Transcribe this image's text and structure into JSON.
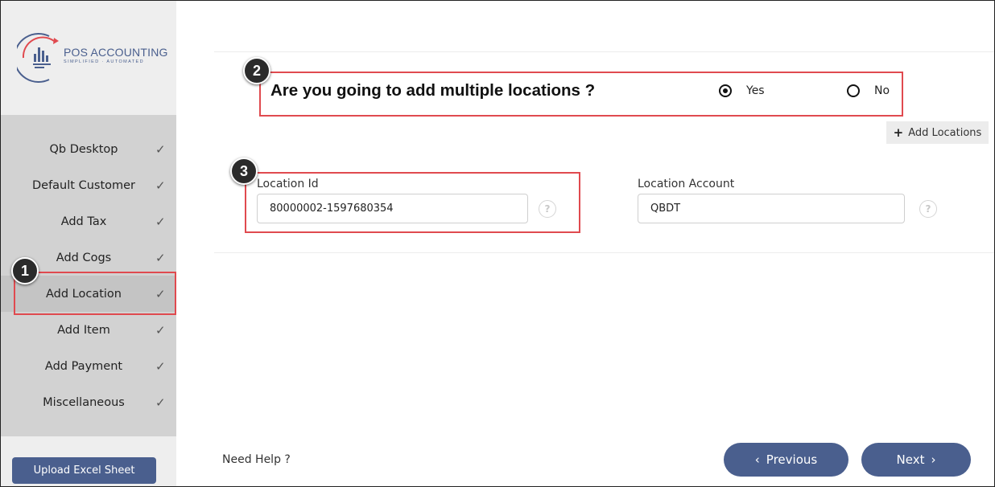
{
  "sidebar": {
    "logo": {
      "title": "POS ACCOUNTING",
      "tagline": "SIMPLIFIED · AUTOMATED"
    },
    "steps": [
      {
        "label": "Qb Desktop",
        "check": "✓"
      },
      {
        "label": "Default Customer",
        "check": "✓"
      },
      {
        "label": "Add Tax",
        "check": "✓"
      },
      {
        "label": "Add Cogs",
        "check": "✓"
      },
      {
        "label": "Add Location",
        "check": "✓"
      },
      {
        "label": "Add Item",
        "check": "✓"
      },
      {
        "label": "Add Payment",
        "check": "✓"
      },
      {
        "label": "Miscellaneous",
        "check": "✓"
      }
    ],
    "upload_label": "Upload Excel Sheet"
  },
  "markers": {
    "one": "1",
    "two": "2",
    "three": "3"
  },
  "main": {
    "question": "Are you going to add multiple locations ?",
    "yes_label": "Yes",
    "no_label": "No",
    "add_locations_label": "Add Locations",
    "location_id_label": "Location Id",
    "location_id_value": "80000002-1597680354",
    "location_account_label": "Location Account",
    "location_account_value": "QBDT",
    "help_glyph": "?",
    "need_help": "Need Help ?",
    "previous_label": "Previous",
    "next_label": "Next"
  },
  "colors": {
    "accent": "#4a5f8e",
    "highlight": "#e04a4f",
    "sidebar_bg": "#eeeeee",
    "steps_bg": "#d2d2d2"
  }
}
